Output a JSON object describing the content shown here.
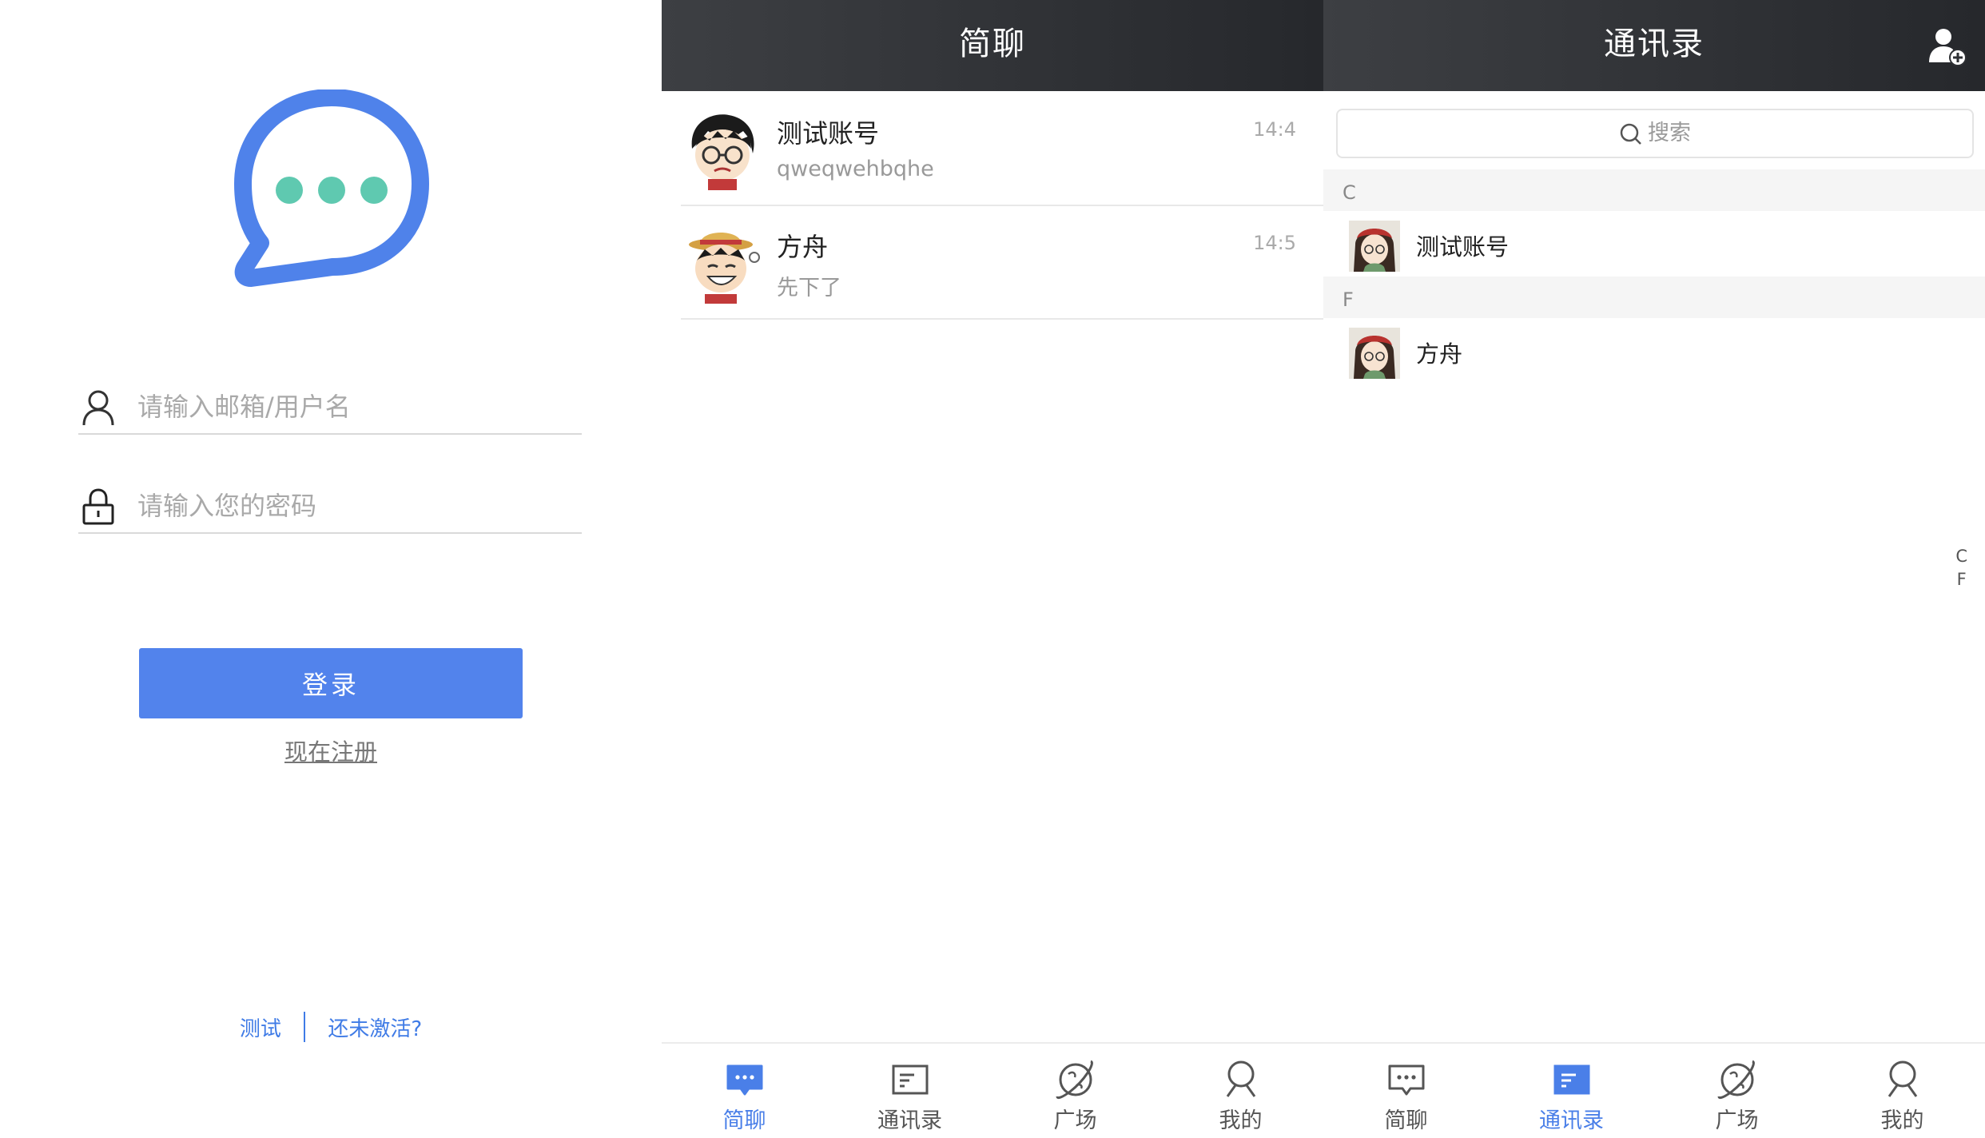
{
  "colors": {
    "accent": "#5283ec",
    "header": "#2e3034",
    "link": "#3f7be6",
    "logo_dots": "#5fc9b0"
  },
  "login": {
    "username_placeholder": "请输入邮箱/用户名",
    "password_placeholder": "请输入您的密码",
    "login_button": "登录",
    "register_link": "现在注册",
    "footer_test": "测试",
    "footer_not_activated": "还未激活?"
  },
  "chats": {
    "title": "简聊",
    "items": [
      {
        "name": "测试账号",
        "message": "qweqwehbqhe",
        "time": "14:4"
      },
      {
        "name": "方舟",
        "message": "先下了",
        "time": "14:5"
      }
    ]
  },
  "contacts": {
    "title": "通讯录",
    "search_placeholder": "搜索",
    "sections": [
      {
        "letter": "C",
        "items": [
          "测试账号"
        ]
      },
      {
        "letter": "F",
        "items": [
          "方舟"
        ]
      }
    ],
    "index": [
      "C",
      "F"
    ]
  },
  "tabs": [
    {
      "label": "简聊",
      "icon": "chat-bubble-icon"
    },
    {
      "label": "通讯录",
      "icon": "contacts-card-icon"
    },
    {
      "label": "广场",
      "icon": "planet-icon"
    },
    {
      "label": "我的",
      "icon": "person-icon"
    }
  ]
}
